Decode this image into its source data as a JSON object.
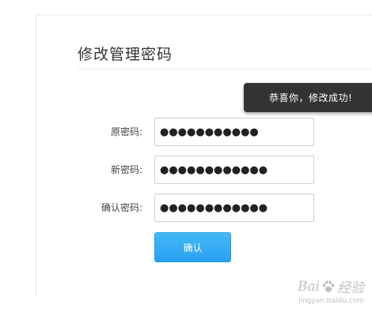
{
  "page": {
    "title": "修改管理密码"
  },
  "toast": {
    "message": "恭喜你，修改成功!"
  },
  "form": {
    "old_password": {
      "label": "原密码:",
      "value": "●●●●●●●●●●●"
    },
    "new_password": {
      "label": "新密码:",
      "value": "●●●●●●●●●●●●"
    },
    "confirm_password": {
      "label": "确认密码:",
      "value": "●●●●●●●●●●●●"
    },
    "confirm_button_label": "确认"
  },
  "watermark": {
    "brand_left": "Bai",
    "brand_right": "经验",
    "url": "jingyan.baidu.com"
  },
  "colors": {
    "accent": "#2a9ff0",
    "toast_bg": "#333333",
    "title": "#333333"
  }
}
